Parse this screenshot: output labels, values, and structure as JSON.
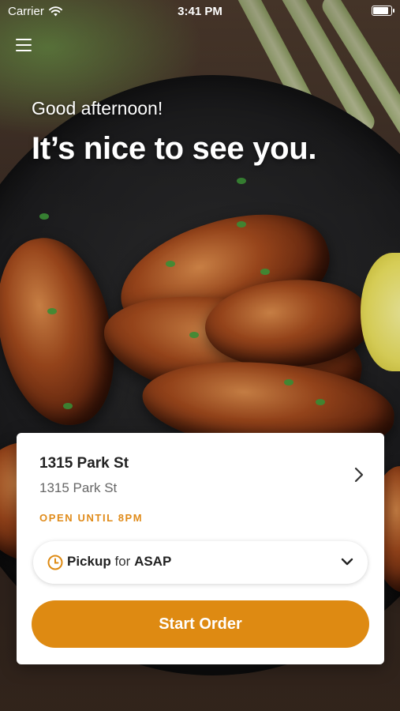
{
  "status_bar": {
    "carrier": "Carrier",
    "time": "3:41 PM",
    "battery_level": 1.0
  },
  "header": {
    "menu_icon": "hamburger-menu-icon"
  },
  "greeting": {
    "subtitle": "Good afternoon!",
    "title": "It’s nice to see you."
  },
  "store_card": {
    "name": "1315 Park St",
    "address": "1315 Park St",
    "hours": "OPEN UNTIL 8PM",
    "order_mode": {
      "mode": "Pickup",
      "connector": "for",
      "time": "ASAP",
      "icon": "clock-icon"
    },
    "start_button_label": "Start Order"
  },
  "colors": {
    "accent": "#de8a12",
    "hours_text": "#e08b1a",
    "card_bg": "#ffffff"
  }
}
